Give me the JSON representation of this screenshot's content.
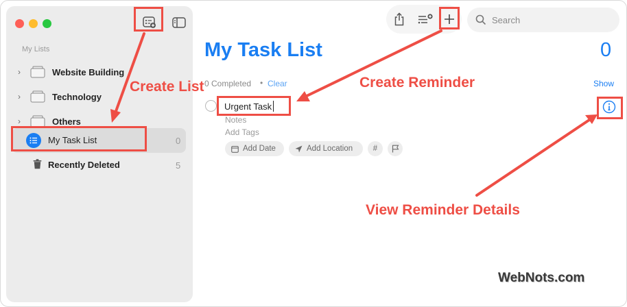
{
  "sidebar": {
    "section_label": "My Lists",
    "groups": [
      {
        "label": "Website Building"
      },
      {
        "label": "Technology"
      },
      {
        "label": "Others"
      }
    ],
    "selected_list": {
      "label": "My Task List",
      "count": "0"
    },
    "recently_deleted": {
      "label": "Recently Deleted",
      "count": "5"
    }
  },
  "search": {
    "placeholder": "Search"
  },
  "main": {
    "title": "My Task List",
    "count": "0",
    "completed_text": "0 Completed",
    "separator": "•",
    "clear_label": "Clear",
    "show_label": "Show",
    "task": {
      "title": "Urgent Task",
      "notes_placeholder": "Notes",
      "tags_placeholder": "Add Tags",
      "add_date_label": "Add Date",
      "add_location_label": "Add Location",
      "tag_symbol": "#"
    }
  },
  "annotations": {
    "create_list": "Create List",
    "create_reminder": "Create Reminder",
    "view_details": "View Reminder Details"
  },
  "watermark": "WebNots.com",
  "colors": {
    "accent": "#1a7ef2",
    "annotation": "#ee4e45"
  }
}
